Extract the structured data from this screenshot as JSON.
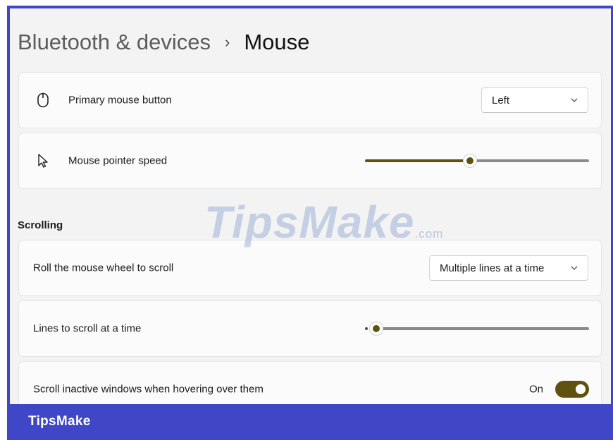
{
  "breadcrumb": {
    "parent": "Bluetooth & devices",
    "separator": "›",
    "current": "Mouse"
  },
  "primary_button": {
    "label": "Primary mouse button",
    "icon": "mouse-icon",
    "value": "Left"
  },
  "pointer_speed": {
    "label": "Mouse pointer speed",
    "icon": "pointer-icon",
    "level": 0.47
  },
  "scrolling": {
    "section_title": "Scrolling",
    "roll_wheel": {
      "label": "Roll the mouse wheel to scroll",
      "value": "Multiple lines at a time"
    },
    "lines": {
      "label": "Lines to scroll at a time",
      "level": 0.05
    },
    "inactive": {
      "label": "Scroll inactive windows when hovering over them",
      "state_text": "On",
      "enabled": true
    }
  },
  "watermark": {
    "main": "TipsMake",
    "suffix": ".com"
  },
  "footer": {
    "brand": "TipsMake"
  },
  "colors": {
    "frame": "#3f47c7",
    "accent": "#5f5210",
    "background": "#f3f3f3"
  }
}
